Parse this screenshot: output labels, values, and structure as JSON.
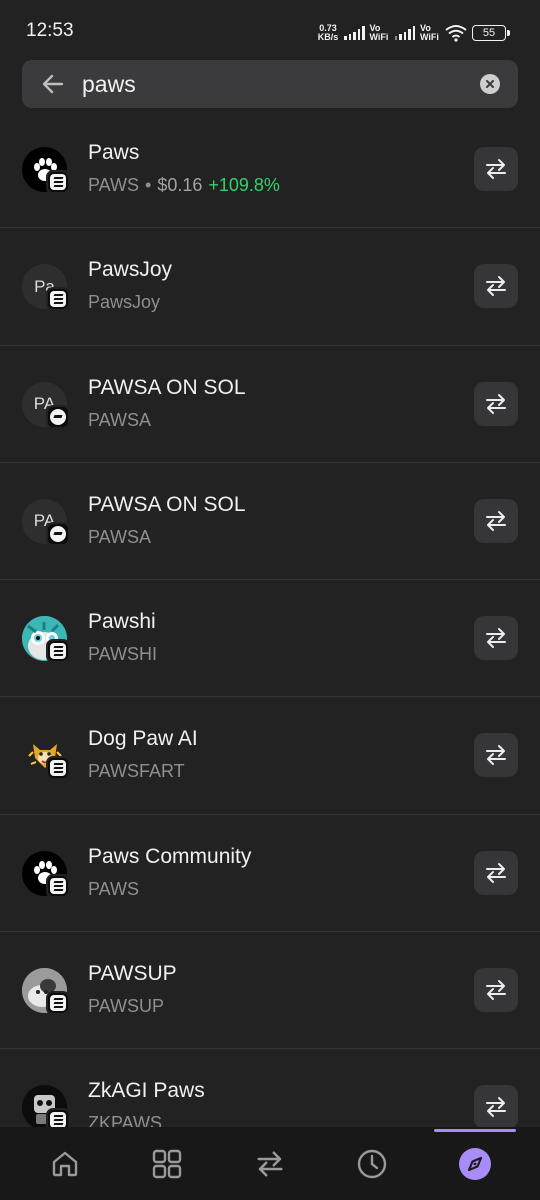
{
  "status_bar": {
    "time": "12:53",
    "speed_value": "0.73",
    "speed_unit": "KB/s",
    "vo_wifi_1": "Vo WiFi",
    "vo_wifi_2": "Vo WiFi",
    "battery": "55"
  },
  "search": {
    "value": "paws"
  },
  "tokens": [
    {
      "name": "Paws",
      "symbol": "PAWS",
      "price": "$0.16",
      "change": "+109.8%",
      "avatar_text": "",
      "avatar_kind": "paw-black"
    },
    {
      "name": "PawsJoy",
      "symbol": "PawsJoy",
      "avatar_text": "Pa",
      "avatar_kind": "text"
    },
    {
      "name": "PAWSA ON SOL",
      "symbol": "PAWSA",
      "avatar_text": "PA",
      "avatar_kind": "text"
    },
    {
      "name": "PAWSA ON SOL",
      "symbol": "PAWSA",
      "avatar_text": "PA",
      "avatar_kind": "text"
    },
    {
      "name": "Pawshi",
      "symbol": "PAWSHI",
      "avatar_text": "",
      "avatar_kind": "pawshi"
    },
    {
      "name": "Dog Paw AI",
      "symbol": "PAWSFART",
      "avatar_text": "",
      "avatar_kind": "dog"
    },
    {
      "name": "Paws Community",
      "symbol": "PAWS",
      "avatar_text": "",
      "avatar_kind": "paw-black"
    },
    {
      "name": "PAWSUP",
      "symbol": "PAWSUP",
      "avatar_text": "",
      "avatar_kind": "photo"
    },
    {
      "name": "ZkAGI Paws",
      "symbol": "ZKPAWS",
      "avatar_text": "",
      "avatar_kind": "robot"
    }
  ],
  "bottom_nav": [
    {
      "name": "home-icon"
    },
    {
      "name": "grid-icon"
    },
    {
      "name": "swap-icon"
    },
    {
      "name": "history-icon"
    },
    {
      "name": "explore-icon",
      "active": true
    }
  ],
  "colors": {
    "background": "#222222",
    "positive": "#30d26a",
    "accent": "#a88dfa"
  }
}
